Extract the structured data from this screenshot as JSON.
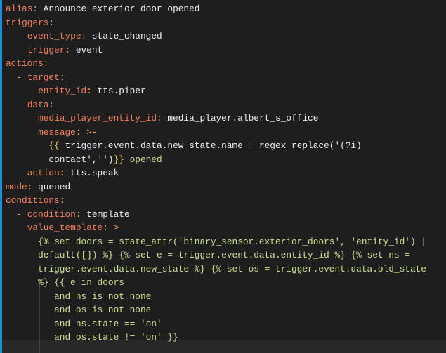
{
  "editor": {
    "colors": {
      "accent": "#1f8ad2",
      "background": "#1e1e1e",
      "key": "#f0805c",
      "template": "#c9e08e"
    },
    "lines": [
      {
        "tokens": [
          {
            "t": "key",
            "text": "alias"
          },
          {
            "t": "punct",
            "text": ": "
          },
          {
            "t": "value",
            "text": "Announce exterior door opened"
          }
        ]
      },
      {
        "tokens": [
          {
            "t": "key",
            "text": "triggers"
          },
          {
            "t": "punct",
            "text": ":"
          }
        ]
      },
      {
        "tokens": [
          {
            "t": "punct",
            "text": "  - "
          },
          {
            "t": "key",
            "text": "event_type"
          },
          {
            "t": "punct",
            "text": ": "
          },
          {
            "t": "value",
            "text": "state_changed"
          }
        ]
      },
      {
        "tokens": [
          {
            "t": "key",
            "text": "    trigger"
          },
          {
            "t": "punct",
            "text": ": "
          },
          {
            "t": "value",
            "text": "event"
          }
        ]
      },
      {
        "tokens": [
          {
            "t": "key",
            "text": "actions"
          },
          {
            "t": "punct",
            "text": ":"
          }
        ]
      },
      {
        "tokens": [
          {
            "t": "punct",
            "text": "  - "
          },
          {
            "t": "key",
            "text": "target"
          },
          {
            "t": "punct",
            "text": ":"
          }
        ]
      },
      {
        "tokens": [
          {
            "t": "key",
            "text": "      entity_id"
          },
          {
            "t": "punct",
            "text": ": "
          },
          {
            "t": "value",
            "text": "tts.piper"
          }
        ]
      },
      {
        "tokens": [
          {
            "t": "key",
            "text": "    data"
          },
          {
            "t": "punct",
            "text": ":"
          }
        ]
      },
      {
        "tokens": [
          {
            "t": "key",
            "text": "      media_player_entity_id"
          },
          {
            "t": "punct",
            "text": ": "
          },
          {
            "t": "value",
            "text": "media_player.albert_s_office"
          }
        ]
      },
      {
        "tokens": [
          {
            "t": "key",
            "text": "      message"
          },
          {
            "t": "punct",
            "text": ": >-"
          }
        ]
      },
      {
        "tokens": [
          {
            "t": "brace",
            "text": "        {{"
          },
          {
            "t": "value",
            "text": " trigger.event.data.new_state.name | regex_replace('(?i)"
          }
        ]
      },
      {
        "tokens": [
          {
            "t": "value",
            "text": "        contact','')"
          },
          {
            "t": "brace",
            "text": "}}"
          },
          {
            "t": "tmpl",
            "text": " opened"
          }
        ]
      },
      {
        "tokens": [
          {
            "t": "key",
            "text": "    action"
          },
          {
            "t": "punct",
            "text": ": "
          },
          {
            "t": "value",
            "text": "tts.speak"
          }
        ]
      },
      {
        "tokens": [
          {
            "t": "key",
            "text": "mode"
          },
          {
            "t": "punct",
            "text": ": "
          },
          {
            "t": "value",
            "text": "queued"
          }
        ]
      },
      {
        "tokens": [
          {
            "t": "key",
            "text": "conditions"
          },
          {
            "t": "punct",
            "text": ":"
          }
        ]
      },
      {
        "tokens": [
          {
            "t": "punct",
            "text": "  - "
          },
          {
            "t": "key",
            "text": "condition"
          },
          {
            "t": "punct",
            "text": ": "
          },
          {
            "t": "value",
            "text": "template"
          }
        ]
      },
      {
        "tokens": [
          {
            "t": "key",
            "text": "    value_template"
          },
          {
            "t": "punct",
            "text": ": >"
          }
        ]
      },
      {
        "tokens": [
          {
            "t": "tmpl",
            "text": "      {% set doors = state_attr('binary_sensor.exterior_doors', 'entity_id') |"
          }
        ]
      },
      {
        "tokens": [
          {
            "t": "tmpl",
            "text": "      default([]) %} {% set e = trigger.event.data.entity_id %} {% set ns ="
          }
        ]
      },
      {
        "tokens": [
          {
            "t": "tmpl",
            "text": "      trigger.event.data.new_state %} {% set os = trigger.event.data.old_state"
          }
        ]
      },
      {
        "tokens": [
          {
            "t": "tmpl",
            "text": "      %} {{ e in doors"
          }
        ]
      },
      {
        "tokens": [
          {
            "t": "tmpl",
            "text": "         and ns is not none"
          }
        ]
      },
      {
        "tokens": [
          {
            "t": "tmpl",
            "text": "         and os is not none"
          }
        ]
      },
      {
        "tokens": [
          {
            "t": "tmpl",
            "text": "         and ns.state == 'on'"
          }
        ]
      },
      {
        "tokens": [
          {
            "t": "tmpl",
            "text": "         and os.state != 'on' }}"
          }
        ]
      }
    ]
  }
}
